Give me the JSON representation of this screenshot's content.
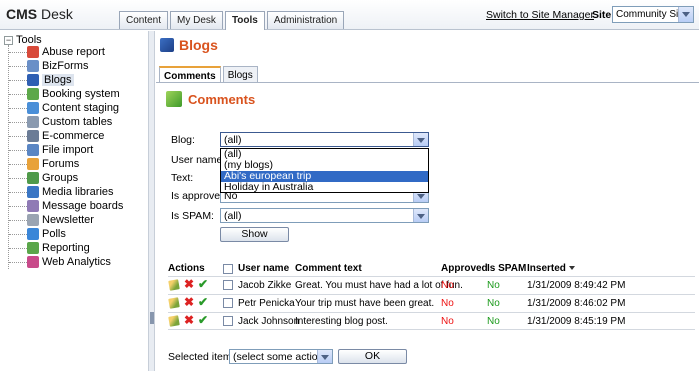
{
  "header": {
    "logo_bold": "CMS",
    "logo_rest": "Desk",
    "tabs": [
      {
        "label": "Content"
      },
      {
        "label": "My Desk"
      },
      {
        "label": "Tools"
      },
      {
        "label": "Administration"
      }
    ],
    "switch_link": "Switch to Site Manager",
    "site_label": "Site:",
    "site_value": "Community Site"
  },
  "tree": {
    "root": "Tools",
    "items": [
      {
        "label": "Abuse report",
        "icon": "abuse-report-icon",
        "color": "#d84a3a"
      },
      {
        "label": "BizForms",
        "icon": "bizforms-icon",
        "color": "#6a8fc7"
      },
      {
        "label": "Blogs",
        "icon": "blogs-icon",
        "color": "#2f5fb3"
      },
      {
        "label": "Booking system",
        "icon": "booking-system-icon",
        "color": "#5da84a"
      },
      {
        "label": "Content staging",
        "icon": "content-staging-icon",
        "color": "#4a8fd8"
      },
      {
        "label": "Custom tables",
        "icon": "custom-tables-icon",
        "color": "#8a9ab0"
      },
      {
        "label": "E-commerce",
        "icon": "e-commerce-icon",
        "color": "#6b7c96"
      },
      {
        "label": "File import",
        "icon": "file-import-icon",
        "color": "#5a86c4"
      },
      {
        "label": "Forums",
        "icon": "forums-icon",
        "color": "#e8a23a"
      },
      {
        "label": "Groups",
        "icon": "groups-icon",
        "color": "#4f9a4a"
      },
      {
        "label": "Media libraries",
        "icon": "media-libraries-icon",
        "color": "#3a76c4"
      },
      {
        "label": "Message boards",
        "icon": "message-boards-icon",
        "color": "#8f7ab5"
      },
      {
        "label": "Newsletter",
        "icon": "newsletter-icon",
        "color": "#9aa4b2"
      },
      {
        "label": "Polls",
        "icon": "polls-icon",
        "color": "#3a86d8"
      },
      {
        "label": "Reporting",
        "icon": "reporting-icon",
        "color": "#5aa64a"
      },
      {
        "label": "Web Analytics",
        "icon": "web-analytics-icon",
        "color": "#c84a8a"
      }
    ]
  },
  "page": {
    "title": "Blogs",
    "subtabs": [
      {
        "label": "Comments"
      },
      {
        "label": "Blogs"
      }
    ],
    "section_title": "Comments"
  },
  "filter": {
    "blog_label": "Blog:",
    "blog_value": "(all)",
    "blog_options": [
      "(all)",
      "(my blogs)",
      "Abi's european trip",
      "Holiday in Australia"
    ],
    "user_label": "User name:",
    "text_label": "Text:",
    "approved_label": "Is approved:",
    "approved_value": "No",
    "spam_label": "Is SPAM:",
    "spam_value": "(all)",
    "show_button": "Show"
  },
  "table": {
    "headers": {
      "actions": "Actions",
      "user": "User name",
      "text": "Comment text",
      "approved": "Approved",
      "spam": "Is SPAM",
      "inserted": "Inserted"
    },
    "rows": [
      {
        "user": "Jacob Zikke",
        "text": "Great. You must have had a lot of fun.",
        "approved": "No",
        "spam": "No",
        "inserted": "1/31/2009 8:49:42 PM"
      },
      {
        "user": "Petr Penicka",
        "text": "Your trip must have been great.",
        "approved": "No",
        "spam": "No",
        "inserted": "1/31/2009 8:46:02 PM"
      },
      {
        "user": "Jack Johnson",
        "text": "Interesting blog post.",
        "approved": "No",
        "spam": "No",
        "inserted": "1/31/2009 8:45:19 PM"
      }
    ]
  },
  "footer": {
    "selected_label": "Selected items:",
    "action_value": "(select some action)",
    "ok_button": "OK"
  }
}
